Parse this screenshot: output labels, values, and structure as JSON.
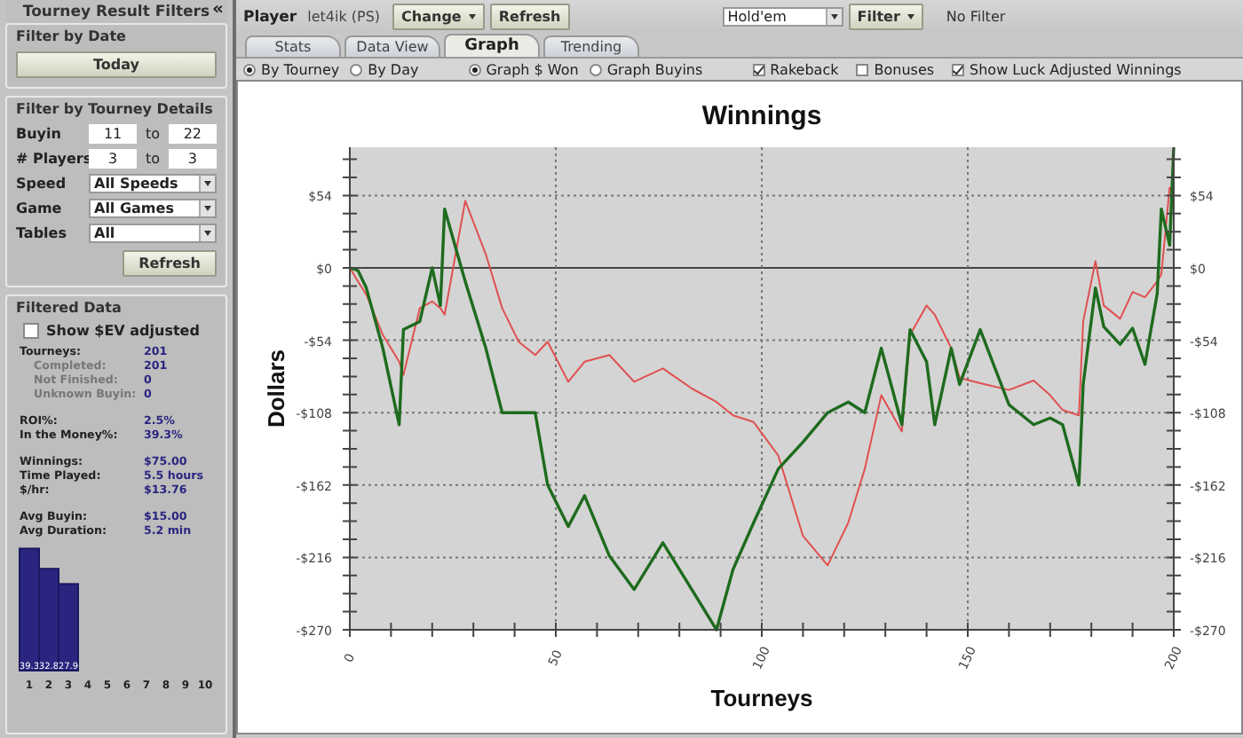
{
  "sidebar": {
    "title": "Tourney Result Filters",
    "collapse": "«",
    "date_section": {
      "heading": "Filter by Date",
      "button": "Today"
    },
    "details_section": {
      "heading": "Filter by Tourney Details",
      "ranges": [
        {
          "label": "Buyin",
          "from": "11",
          "to_label": "to",
          "to": "22"
        },
        {
          "label": "# Players",
          "from": "3",
          "to_label": "to",
          "to": "3"
        }
      ],
      "selects": [
        {
          "label": "Speed",
          "value": "All Speeds"
        },
        {
          "label": "Game",
          "value": "All Games"
        },
        {
          "label": "Tables",
          "value": "All"
        }
      ],
      "button": "Refresh"
    },
    "filtered_section": {
      "heading": "Filtered Data",
      "checkbox": {
        "label": "Show $EV adjusted",
        "checked": false
      },
      "groups": [
        [
          {
            "label": "Tourneys:",
            "value": "201",
            "kind": "main"
          },
          {
            "label": "Completed:",
            "value": "201",
            "kind": "sub"
          },
          {
            "label": "Not Finished:",
            "value": "0",
            "kind": "sub"
          },
          {
            "label": "Unknown Buyin:",
            "value": "0",
            "kind": "sub"
          }
        ],
        [
          {
            "label": "ROI%:",
            "value": "2.5%",
            "kind": "main"
          },
          {
            "label": "In the Money%:",
            "value": "39.3%",
            "kind": "main"
          }
        ],
        [
          {
            "label": "Winnings:",
            "value": "$75.00",
            "kind": "main"
          },
          {
            "label": "Time Played:",
            "value": "5.5 hours",
            "kind": "main"
          },
          {
            "label": "$/hr:",
            "value": "$13.76",
            "kind": "main"
          }
        ],
        [
          {
            "label": "Avg Buyin:",
            "value": "$15.00",
            "kind": "main"
          },
          {
            "label": "Avg Duration:",
            "value": "5.2 min",
            "kind": "main"
          }
        ]
      ],
      "chart_data": {
        "type": "bar",
        "categories": [
          "1",
          "2",
          "3",
          "4",
          "5",
          "6",
          "7",
          "8",
          "9",
          "10"
        ],
        "series": [
          {
            "color": "#2a2680",
            "values": [
              39.3,
              32.8,
              27.9,
              null,
              null,
              null,
              null,
              null,
              null,
              null
            ]
          }
        ],
        "data_labels": true
      }
    }
  },
  "toolbar": {
    "player_label": "Player",
    "player": "let4ik (PS)",
    "change_button": "Change",
    "refresh_button": "Refresh",
    "game_select": "Hold'em",
    "filter_button": "Filter",
    "filter_status": "No Filter"
  },
  "tabs": [
    {
      "label": "Stats",
      "selected": false
    },
    {
      "label": "Data View",
      "selected": false
    },
    {
      "label": "Graph",
      "selected": true
    },
    {
      "label": "Trending",
      "selected": false
    }
  ],
  "options": {
    "radio_groups": [
      [
        {
          "label": "By Tourney",
          "selected": true
        },
        {
          "label": "By Day",
          "selected": false
        }
      ],
      [
        {
          "label": "Graph $ Won",
          "selected": true
        },
        {
          "label": "Graph Buyins",
          "selected": false
        }
      ]
    ],
    "checkboxes": [
      {
        "label": "Rakeback",
        "checked": true
      },
      {
        "label": "Bonuses",
        "checked": false
      },
      {
        "label": "Show Luck Adjusted Winnings",
        "checked": true
      }
    ]
  },
  "graph": {
    "chart_data": {
      "type": "line",
      "title": "Winnings",
      "xlabel": "Tourneys",
      "ylabel": "Dollars",
      "x": [
        0,
        2,
        4,
        8,
        12,
        13,
        17,
        20,
        22,
        23,
        28,
        33,
        37,
        41,
        45,
        48,
        53,
        57,
        63,
        69,
        76,
        83,
        89,
        93,
        98,
        104,
        110,
        116,
        121,
        125,
        129,
        134,
        136,
        140,
        142,
        146,
        148,
        153,
        160,
        166,
        170,
        173,
        177,
        178,
        181,
        183,
        187,
        190,
        193,
        196,
        197,
        199,
        200
      ],
      "series": [
        {
          "color": "#1e6b1e",
          "values": [
            0,
            -2,
            -15,
            -60,
            -117,
            -46,
            -40,
            0,
            -28,
            44,
            -10,
            -60,
            -108,
            -108,
            -108,
            -162,
            -193,
            -170,
            -215,
            -240,
            -205,
            -240,
            -270,
            -225,
            -190,
            -150,
            -130,
            -108,
            -100,
            -108,
            -60,
            -117,
            -46,
            -70,
            -117,
            -60,
            -87,
            -46,
            -102,
            -117,
            -112,
            -117,
            -162,
            -87,
            -15,
            -44,
            -57,
            -45,
            -72,
            -19,
            44,
            17,
            90
          ]
        },
        {
          "color": "#e05050",
          "values": [
            0,
            -10,
            -20,
            -50,
            -70,
            -80,
            -30,
            -25,
            -30,
            -35,
            50,
            10,
            -30,
            -55,
            -65,
            -55,
            -85,
            -70,
            -65,
            -85,
            -75,
            -90,
            -100,
            -110,
            -115,
            -140,
            -200,
            -222,
            -190,
            -150,
            -95,
            -122,
            -50,
            -28,
            -35,
            -60,
            -82,
            -86,
            -91,
            -84,
            -95,
            -106,
            -110,
            -40,
            5,
            -28,
            -38,
            -18,
            -22,
            -10,
            -5,
            60,
            55
          ]
        }
      ],
      "grid": true,
      "xlim": [
        0,
        200
      ],
      "ylim": [
        -270,
        90
      ],
      "xticks": [
        0,
        50,
        100,
        150,
        200
      ],
      "yticks": [
        {
          "value": 54,
          "label": "$54"
        },
        {
          "value": 0,
          "label": "$0"
        },
        {
          "value": -54,
          "label": "-$54"
        },
        {
          "value": -108,
          "label": "-$108"
        },
        {
          "value": -162,
          "label": "-$162"
        },
        {
          "value": -216,
          "label": "-$216"
        },
        {
          "value": -270,
          "label": "-$270"
        }
      ]
    }
  }
}
